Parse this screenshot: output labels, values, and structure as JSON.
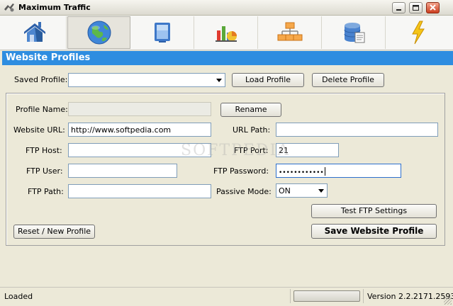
{
  "window": {
    "title": "Maximum Traffic",
    "controls": [
      "minimize-button",
      "maximize-button",
      "close-button"
    ]
  },
  "toolbar": {
    "tools": [
      {
        "icon": "home-icon",
        "active": false
      },
      {
        "icon": "globe-icon",
        "active": true
      },
      {
        "icon": "monitor-icon",
        "active": false
      },
      {
        "icon": "chart-icon",
        "active": false
      },
      {
        "icon": "sitemap-icon",
        "active": false
      },
      {
        "icon": "database-icon",
        "active": false
      },
      {
        "icon": "lightning-icon",
        "active": false
      }
    ]
  },
  "section": {
    "title": "Website Profiles"
  },
  "profile": {
    "saved_label": "Saved Profile:",
    "saved_value": "",
    "load_button": "Load Profile",
    "delete_button": "Delete Profile"
  },
  "form": {
    "profile_name_label": "Profile Name:",
    "profile_name_value": "",
    "rename_button": "Rename",
    "website_url_label": "Website URL:",
    "website_url_value": "http://www.softpedia.com",
    "url_path_label": "URL Path:",
    "url_path_value": "",
    "ftp_host_label": "FTP Host:",
    "ftp_host_value": "",
    "ftp_port_label": "FTP Port:",
    "ftp_port_value": "21",
    "ftp_user_label": "FTP User:",
    "ftp_user_value": "",
    "ftp_password_label": "FTP Password:",
    "ftp_password_value": "••••••••••••",
    "ftp_path_label": "FTP Path:",
    "ftp_path_value": "",
    "passive_mode_label": "Passive Mode:",
    "passive_mode_value": "ON",
    "test_button": "Test FTP Settings",
    "reset_button": "Reset / New Profile",
    "save_button": "Save Website Profile"
  },
  "status": {
    "text": "Loaded",
    "version": "Version 2.2.2171.2593"
  },
  "watermark": "SOFTPEDIA",
  "colors": {
    "accent": "#2e8de0",
    "window_bg": "#ece9d8",
    "input_border": "#7f9db9"
  }
}
